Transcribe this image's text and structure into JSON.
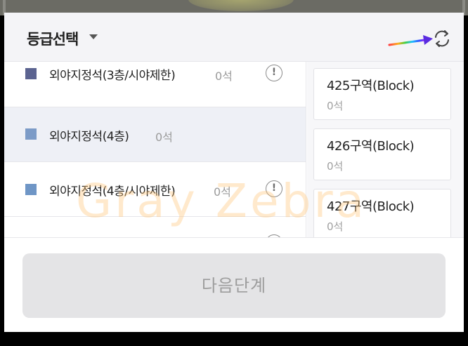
{
  "header": {
    "title": "등급선택",
    "caret_icon": "caret-down-icon",
    "refresh_icon": "refresh-icon"
  },
  "grades": [
    {
      "name": "외야지정석(3층/시야제한)",
      "count": "0석",
      "color": "#5b6390",
      "info": true,
      "selected": false
    },
    {
      "name": "외야지정석(4층)",
      "count": "0석",
      "color": "#7c9bc7",
      "info": false,
      "selected": true
    },
    {
      "name": "외야지정석(4층/시야제한)",
      "count": "0석",
      "color": "#6f96c6",
      "info": true,
      "selected": false
    }
  ],
  "blocks": [
    {
      "name": "425구역(Block)",
      "count": "0석"
    },
    {
      "name": "426구역(Block)",
      "count": "0석"
    },
    {
      "name": "427구역(Block)",
      "count": "0석"
    }
  ],
  "info_symbol": "!",
  "next_button_label": "다음단계",
  "watermark": "Gray Zebra",
  "colors": {
    "header_bg": "#f4f4f7",
    "selected_row_bg": "#eef0f6",
    "disabled_button_bg": "#e4e4e6",
    "disabled_button_text": "#9d9d9d"
  }
}
